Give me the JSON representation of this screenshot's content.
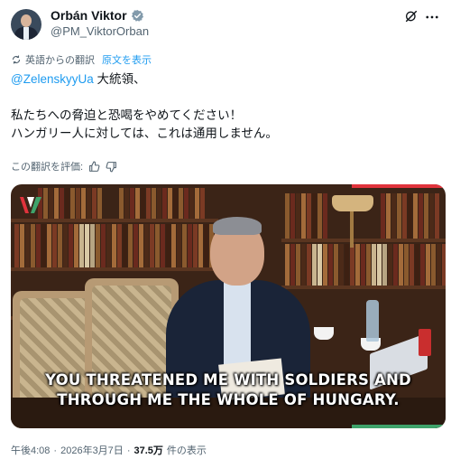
{
  "header": {
    "name": "Orbán Viktor",
    "handle": "@PM_ViktorOrban"
  },
  "translation": {
    "notice": "英語からの翻訳",
    "show_original": "原文を表示"
  },
  "tweet": {
    "mention": "@ZelenskyyUa",
    "line1_rest": " 大統領、",
    "line2": "私たちへの脅迫と恐喝をやめてください！",
    "line3": "ハンガリー人に対しては、これは通用しません。"
  },
  "rating": {
    "label": "この翻訳を評価:"
  },
  "media": {
    "caption_line1": "YOU THREATENED ME WITH SOLDIERS AND",
    "caption_line2": "THROUGH ME THE WHOLE OF HUNGARY."
  },
  "meta": {
    "time": "午後4:08",
    "dot1": "·",
    "date": "2026年3月7日",
    "dot2": "·",
    "views": "37.5万",
    "views_label": "件の表示"
  },
  "colors": {
    "accent": "#1d9bf0",
    "text": "#0f1419",
    "muted": "#536471",
    "verified": "#829aab"
  },
  "icons": {
    "verified": "verified-badge-icon",
    "grok": "grok-icon",
    "more": "more-icon",
    "translate": "translate-icon",
    "thumbs_up": "thumbs-up-icon",
    "thumbs_down": "thumbs-down-icon"
  }
}
